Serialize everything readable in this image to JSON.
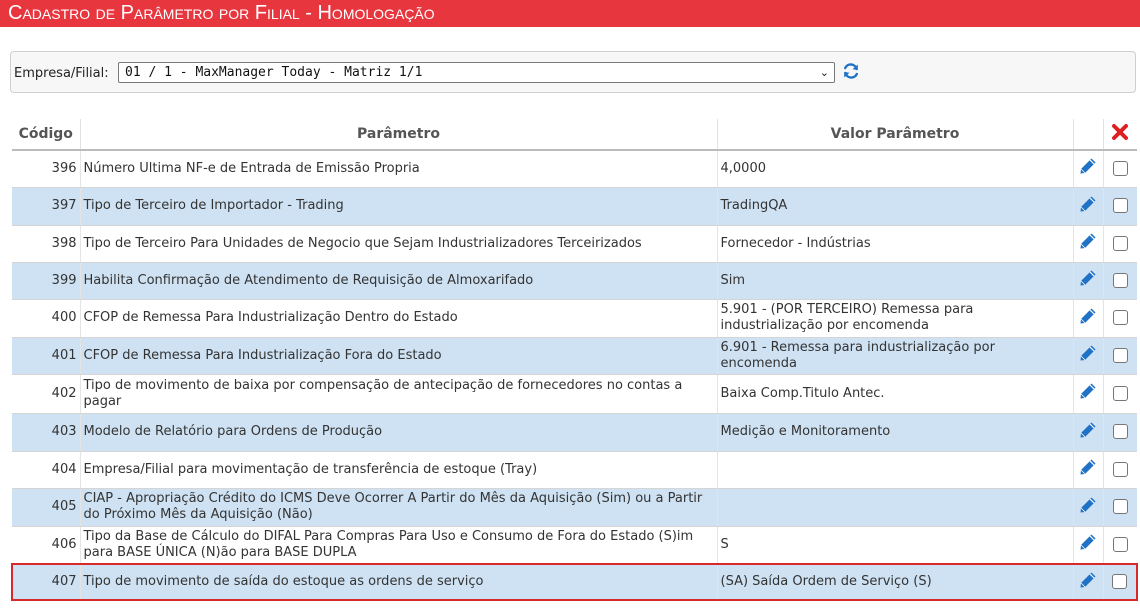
{
  "header": {
    "title": "Cadastro de Parâmetro por Filial  - Homologação"
  },
  "filter": {
    "label": "Empresa/Filial:",
    "selected": "01 / 1 - MaxManager Today - Matriz 1/1"
  },
  "table": {
    "columns": [
      "Código",
      "Parâmetro",
      "Valor Parâmetro"
    ],
    "rows": [
      {
        "code": "396",
        "param": "Número Ultima NF-e de Entrada de Emissão Propria",
        "value": "4,0000"
      },
      {
        "code": "397",
        "param": "Tipo de Terceiro de Importador - Trading",
        "value": "TradingQA"
      },
      {
        "code": "398",
        "param": "Tipo de Terceiro Para Unidades de Negocio que Sejam Industrializadores Terceirizados",
        "value": "Fornecedor - Indústrias"
      },
      {
        "code": "399",
        "param": "Habilita Confirmação de Atendimento de Requisição de Almoxarifado",
        "value": "Sim"
      },
      {
        "code": "400",
        "param": "CFOP de Remessa Para Industrialização Dentro do Estado",
        "value": "5.901 - (POR TERCEIRO) Remessa para industrialização por encomenda"
      },
      {
        "code": "401",
        "param": "CFOP de Remessa Para Industrialização Fora do Estado",
        "value": "6.901 - Remessa para industrialização por encomenda"
      },
      {
        "code": "402",
        "param": "Tipo de movimento de baixa por compensação de antecipação de fornecedores no contas a pagar",
        "value": "Baixa Comp.Titulo Antec."
      },
      {
        "code": "403",
        "param": "Modelo de Relatório para Ordens de Produção",
        "value": "Medição e Monitoramento"
      },
      {
        "code": "404",
        "param": "Empresa/Filial para movimentação de transferência de estoque (Tray)",
        "value": ""
      },
      {
        "code": "405",
        "param": "CIAP - Apropriação Crédito do ICMS Deve Ocorrer A Partir do Mês da Aquisição (Sim) ou a Partir do Próximo Mês da Aquisição (Não)",
        "value": ""
      },
      {
        "code": "406",
        "param": "Tipo da Base de Cálculo do DIFAL Para Compras Para Uso e Consumo de Fora do Estado (S)im para BASE ÚNICA (N)ão para BASE DUPLA",
        "value": "S"
      },
      {
        "code": "407",
        "param": "Tipo de movimento de saída do estoque as ordens de serviço",
        "value": "(SA) Saída Ordem de Serviço (S)"
      }
    ]
  },
  "colors": {
    "header_bg": "#e8363f",
    "row_alt": "#cfe2f3",
    "icon_blue": "#1f72c6",
    "delete_red": "#e02020",
    "highlight": "#d62a2a"
  }
}
